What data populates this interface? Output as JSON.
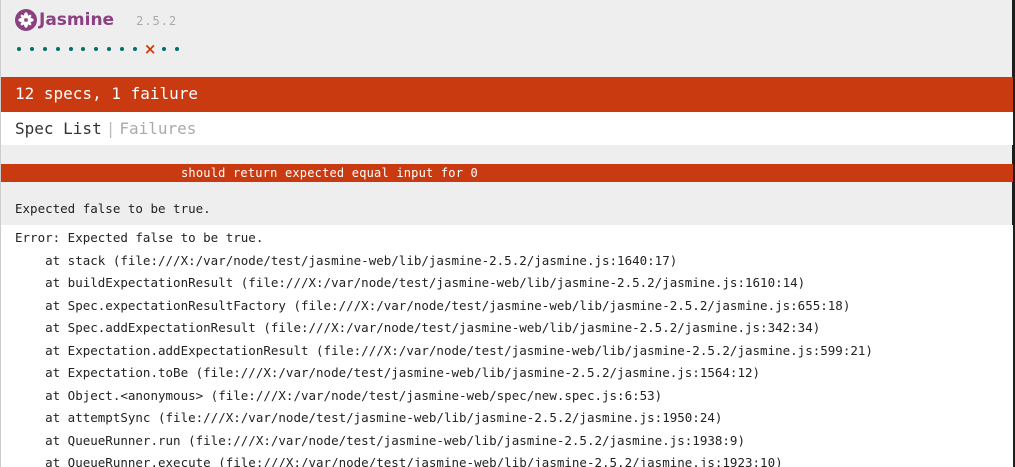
{
  "banner": {
    "title": "Jasmine",
    "version": "2.5.2"
  },
  "symbols": [
    "passed",
    "passed",
    "passed",
    "passed",
    "passed",
    "passed",
    "passed",
    "passed",
    "passed",
    "passed",
    "failed",
    "passed",
    "passed"
  ],
  "summary": {
    "text": "12 specs, 1 failure"
  },
  "menu": {
    "spec_list": "Spec List",
    "separator": "|",
    "failures": "Failures"
  },
  "failure": {
    "spec_name": "should return expected equal input for 0",
    "message": "Expected false to be true.",
    "stack": [
      "Error: Expected false to be true.",
      "    at stack (file:///X:/var/node/test/jasmine-web/lib/jasmine-2.5.2/jasmine.js:1640:17)",
      "    at buildExpectationResult (file:///X:/var/node/test/jasmine-web/lib/jasmine-2.5.2/jasmine.js:1610:14)",
      "    at Spec.expectationResultFactory (file:///X:/var/node/test/jasmine-web/lib/jasmine-2.5.2/jasmine.js:655:18)",
      "    at Spec.addExpectationResult (file:///X:/var/node/test/jasmine-web/lib/jasmine-2.5.2/jasmine.js:342:34)",
      "    at Expectation.addExpectationResult (file:///X:/var/node/test/jasmine-web/lib/jasmine-2.5.2/jasmine.js:599:21)",
      "    at Expectation.toBe (file:///X:/var/node/test/jasmine-web/lib/jasmine-2.5.2/jasmine.js:1564:12)",
      "    at Object.<anonymous> (file:///X:/var/node/test/jasmine-web/spec/new.spec.js:6:53)",
      "    at attemptSync (file:///X:/var/node/test/jasmine-web/lib/jasmine-2.5.2/jasmine.js:1950:24)",
      "    at QueueRunner.run (file:///X:/var/node/test/jasmine-web/lib/jasmine-2.5.2/jasmine.js:1938:9)",
      "    at QueueRunner.execute (file:///X:/var/node/test/jasmine-web/lib/jasmine-2.5.2/jasmine.js:1923:10)"
    ]
  },
  "colors": {
    "brand": "#8a4182",
    "failure": "#ca3a11",
    "passed": "#007069"
  },
  "icons": {
    "logo": "jasmine-flower-icon",
    "failed_symbol": "x-mark-icon"
  }
}
